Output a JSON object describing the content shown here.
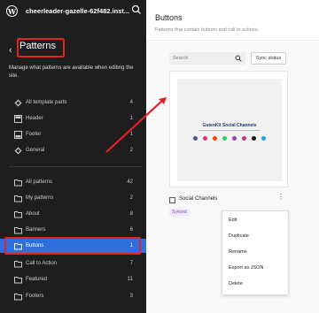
{
  "topbar": {
    "site_title": "cheerleader-gazelle-62f482.inst..."
  },
  "sidebar": {
    "back_label": "‹",
    "title": "Patterns",
    "description": "Manage what patterns are available when editing the site.",
    "template_parts": [
      {
        "label": "All template parts",
        "count": "4",
        "icon": "layers-icon"
      },
      {
        "label": "Header",
        "count": "1",
        "icon": "header-icon"
      },
      {
        "label": "Footer",
        "count": "1",
        "icon": "footer-icon"
      },
      {
        "label": "General",
        "count": "2",
        "icon": "layers-icon"
      }
    ],
    "categories": [
      {
        "label": "All patterns",
        "count": "42"
      },
      {
        "label": "My patterns",
        "count": "2"
      },
      {
        "label": "About",
        "count": "8"
      },
      {
        "label": "Banners",
        "count": "6"
      },
      {
        "label": "Buttons",
        "count": "1"
      },
      {
        "label": "Call to Action",
        "count": "7"
      },
      {
        "label": "Featured",
        "count": "11"
      },
      {
        "label": "Footers",
        "count": "3"
      }
    ]
  },
  "main": {
    "title": "Buttons",
    "subtitle": "Patterns that contain buttons and call to actions.",
    "search_placeholder": "Search",
    "sync_status": "Sync status",
    "preview_heading": "GutenKit Social Channels",
    "pattern_name": "Social Channels",
    "synced_badge": "Synced",
    "menu": [
      "Edit",
      "Duplicate",
      "Rename",
      "Export as JSON",
      "Delete"
    ]
  },
  "colors": {
    "sidebar_bg": "#1e1e1e",
    "active": "#2f6fdd",
    "highlight": "#e12323",
    "dots": [
      "#3b5998",
      "#e1306c",
      "#ff4500",
      "#25d366",
      "#8e44ad",
      "#c13584",
      "#111111",
      "#1da1f2"
    ]
  }
}
